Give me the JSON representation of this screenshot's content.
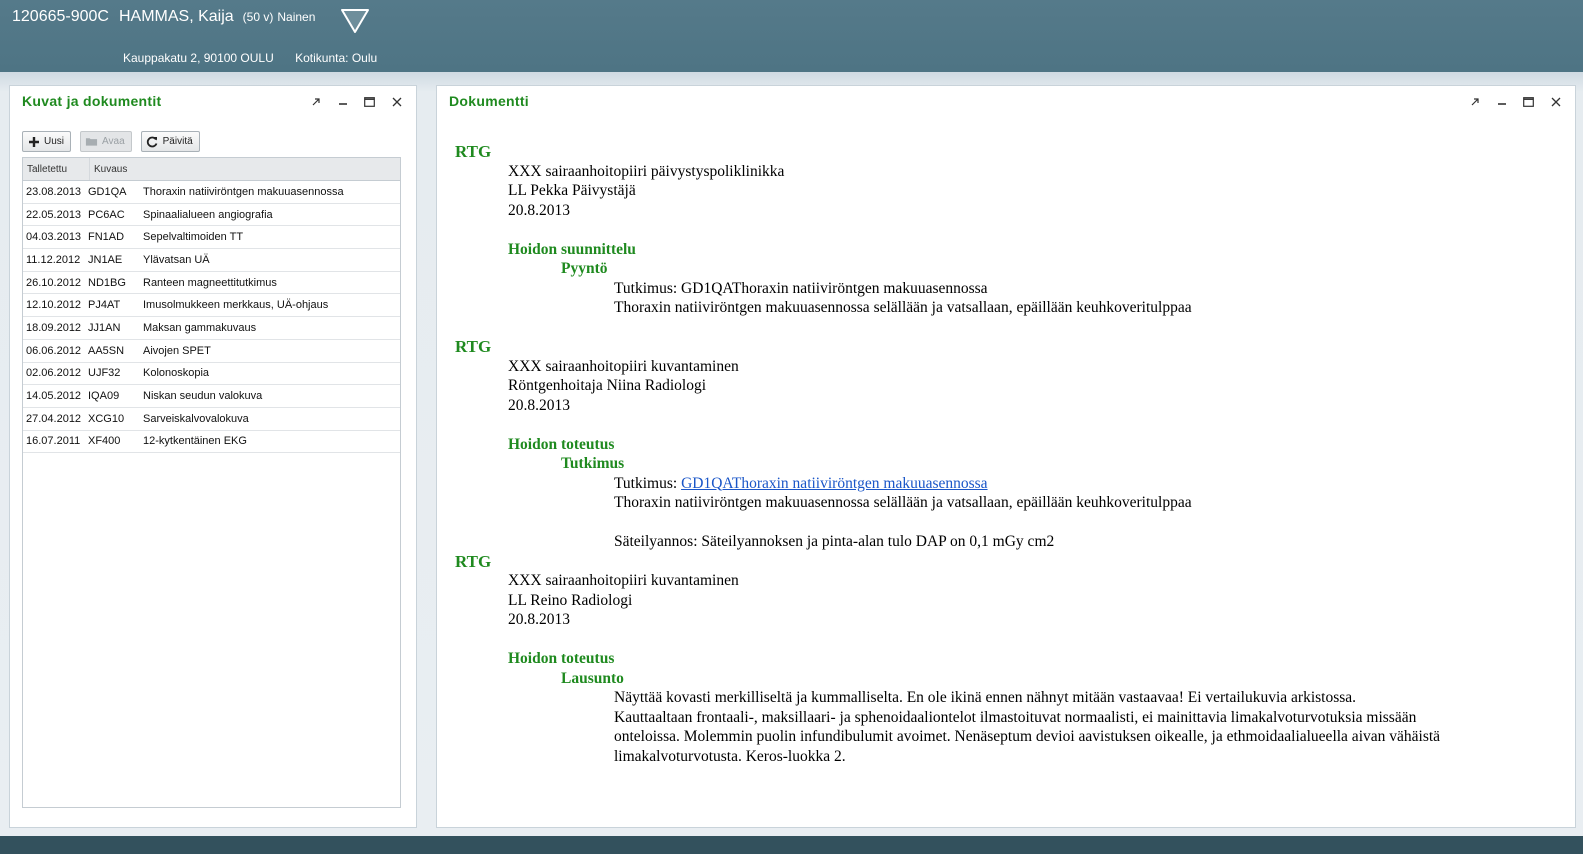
{
  "header": {
    "patient_id": "120665-900C",
    "patient_name": "HAMMAS, Kaija",
    "patient_age": "(50 v)",
    "patient_gender": "Nainen",
    "address": "Kauppakatu 2, 90100 OULU",
    "municipality": "Kotikunta: Oulu"
  },
  "left_panel": {
    "title": "Kuvat ja dokumentit",
    "toolbar": {
      "new_label": "Uusi",
      "open_label": "Avaa",
      "refresh_label": "Päivitä"
    },
    "columns": [
      "Talletettu",
      "Kuvaus"
    ],
    "rows": [
      {
        "date": "23.08.2013",
        "code": "GD1QA",
        "desc": "Thoraxin natiiviröntgen makuuasennossa"
      },
      {
        "date": "22.05.2013",
        "code": "PC6AC",
        "desc": "Spinaalialueen angiografia"
      },
      {
        "date": "04.03.2013",
        "code": "FN1AD",
        "desc": "Sepelvaltimoiden TT"
      },
      {
        "date": "11.12.2012",
        "code": "JN1AE",
        "desc": "Ylävatsan UÄ"
      },
      {
        "date": "26.10.2012",
        "code": "ND1BG",
        "desc": "Ranteen magneettitutkimus"
      },
      {
        "date": "12.10.2012",
        "code": "PJ4AT",
        "desc": "Imusolmukkeen merkkaus, UÄ-ohjaus"
      },
      {
        "date": "18.09.2012",
        "code": "JJ1AN",
        "desc": "Maksan gammakuvaus"
      },
      {
        "date": "06.06.2012",
        "code": "AA5SN",
        "desc": "Aivojen SPET"
      },
      {
        "date": "02.06.2012",
        "code": "UJF32",
        "desc": "Kolonoskopia"
      },
      {
        "date": "14.05.2012",
        "code": "IQA09",
        "desc": "Niskan seudun valokuva"
      },
      {
        "date": "27.04.2012",
        "code": "XCG10",
        "desc": "Sarveiskalvovalokuva"
      },
      {
        "date": "16.07.2011",
        "code": "XF400",
        "desc": "12-kytkentäinen EKG"
      }
    ]
  },
  "right_panel": {
    "title": "Dokumentti",
    "entries": [
      {
        "heading": "RTG",
        "org": "XXX sairaanhoitopiiri päivystyspoliklinikka",
        "author": "LL Pekka Päivystäjä",
        "date": "20.8.2013",
        "section": "Hoidon suunnittelu",
        "subsection": "Pyyntö",
        "line1": "Tutkimus: GD1QAThoraxin natiiviröntgen makuuasennossa",
        "line2": "Thoraxin natiiviröntgen makuuasennossa selällään ja vatsallaan, epäillään keuhkoveritulppaa"
      },
      {
        "heading": "RTG",
        "org": "XXX sairaanhoitopiiri kuvantaminen",
        "author": "Röntgenhoitaja Niina Radiologi",
        "date": "20.8.2013",
        "section": "Hoidon toteutus",
        "subsection": "Tutkimus",
        "line1_prefix": "Tutkimus: ",
        "line1_link": "GD1QAThoraxin natiiviröntgen makuuasennossa",
        "line2": "Thoraxin natiiviröntgen makuuasennossa selällään ja vatsallaan, epäillään keuhkoveritulppaa",
        "line3": "Säteilyannos: Säteilyannoksen ja pinta-alan tulo DAP on 0,1 mGy cm2"
      },
      {
        "heading": "RTG",
        "org": "XXX sairaanhoitopiiri kuvantaminen",
        "author": "LL Reino Radiologi",
        "date": "20.8.2013",
        "section": "Hoidon toteutus",
        "subsection": "Lausunto",
        "para1": "Näyttää kovasti merkilliseltä ja kummalliselta. En ole ikinä ennen nähnyt mitään vastaavaa! Ei vertailukuvia arkistossa.",
        "para2": "Kauttaaltaan frontaali-, maksillaari- ja sphenoidaaliontelot ilmastoituvat normaalisti, ei mainittavia limakalvoturvotuksia missään onteloissa. Molemmin puolin infundibulumit avoimet. Nenäseptum devioi aavistuksen oikealle, ja ethmoidaalialueella aivan vähäistä limakalvoturvotusta. Keros-luokka 2."
      }
    ]
  },
  "colors": {
    "header_bg": "#557a8a",
    "heading_green": "#1f8a1f",
    "link_blue": "#1a56c8"
  }
}
